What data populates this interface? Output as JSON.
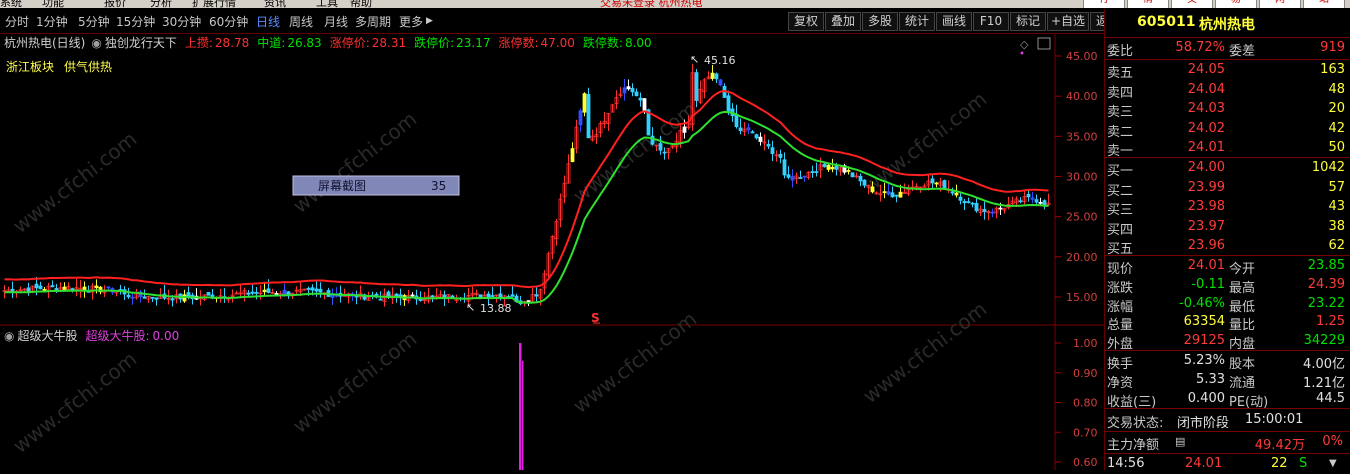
{
  "menu": {
    "items": [
      "系统",
      "功能",
      "报价",
      "分析",
      "扩展行情",
      "资讯",
      "工具",
      "帮助"
    ],
    "center_text": "交易未登录 杭州热电",
    "right_buttons": [
      "行",
      "情",
      "交",
      "易",
      "网",
      "站"
    ]
  },
  "toolbar": {
    "periods": [
      "分时",
      "1分钟",
      "5分钟",
      "15分钟",
      "30分钟",
      "60分钟",
      "日线",
      "周线",
      "月线",
      "多周期",
      "更多"
    ],
    "active_period": "日线",
    "right": [
      "复权",
      "叠加",
      "多股",
      "统计",
      "画线",
      "F10",
      "标记",
      "+自选",
      "返回"
    ]
  },
  "main": {
    "title": "杭州热电(日线)",
    "indicator_name": "独创龙行天下",
    "values": [
      {
        "label": "上攒:",
        "value": "28.78",
        "color": "#ff3030"
      },
      {
        "label": "中道:",
        "value": "26.83",
        "color": "#00e000"
      },
      {
        "label": "涨停价:",
        "value": "28.31",
        "color": "#ff3030"
      },
      {
        "label": "跌停价:",
        "value": "23.17",
        "color": "#00e000"
      },
      {
        "label": "涨停数:",
        "value": "47.00",
        "color": "#ff3030"
      },
      {
        "label": "跌停数:",
        "value": "8.00",
        "color": "#00e000"
      }
    ],
    "tags": [
      "浙江板块",
      "供气供热"
    ],
    "max_label": "45.16",
    "min_label": "13.88",
    "marker": "S",
    "screenshot_box": {
      "label": "屏幕截图",
      "value": "35"
    },
    "y_ticks": [
      "45.00",
      "40.00",
      "35.00",
      "30.00",
      "25.00",
      "20.00",
      "15.00"
    ]
  },
  "sub": {
    "title": "超级大牛股",
    "label": "超级大牛股:",
    "value": "0.00",
    "y_ticks": [
      "1.00",
      "0.90",
      "0.80",
      "0.70",
      "0.60"
    ]
  },
  "watermark": "www.cfchi.com",
  "chart_data": {
    "type": "line",
    "series": [
      {
        "name": "上攒",
        "values": []
      },
      {
        "name": "中道",
        "values": []
      }
    ],
    "ylim": [
      12,
      47
    ]
  },
  "quote": {
    "code": "605011",
    "name": "杭州热电",
    "weibi_label": "委比",
    "weibi": "58.72%",
    "weicha_label": "委差",
    "weicha": "919",
    "sells": [
      {
        "label": "卖五",
        "price": "24.05",
        "vol": "163"
      },
      {
        "label": "卖四",
        "price": "24.04",
        "vol": "48"
      },
      {
        "label": "卖三",
        "price": "24.03",
        "vol": "20"
      },
      {
        "label": "卖二",
        "price": "24.02",
        "vol": "42"
      },
      {
        "label": "卖一",
        "price": "24.01",
        "vol": "50"
      }
    ],
    "buys": [
      {
        "label": "买一",
        "price": "24.00",
        "vol": "1042"
      },
      {
        "label": "买二",
        "price": "23.99",
        "vol": "57"
      },
      {
        "label": "买三",
        "price": "23.98",
        "vol": "43"
      },
      {
        "label": "买四",
        "price": "23.97",
        "vol": "38"
      },
      {
        "label": "买五",
        "price": "23.96",
        "vol": "62"
      }
    ],
    "stats": [
      {
        "l1": "现价",
        "v1": "24.01",
        "c1": "red",
        "l2": "今开",
        "v2": "23.85",
        "c2": "grn"
      },
      {
        "l1": "涨跌",
        "v1": "-0.11",
        "c1": "grn",
        "l2": "最高",
        "v2": "24.39",
        "c2": "red"
      },
      {
        "l1": "涨幅",
        "v1": "-0.46%",
        "c1": "grn",
        "l2": "最低",
        "v2": "23.22",
        "c2": "grn"
      },
      {
        "l1": "总量",
        "v1": "63354",
        "c1": "yel",
        "l2": "量比",
        "v2": "1.25",
        "c2": "red"
      },
      {
        "l1": "外盘",
        "v1": "29125",
        "c1": "red",
        "l2": "内盘",
        "v2": "34229",
        "c2": "grn"
      }
    ],
    "stats2": [
      {
        "l1": "换手",
        "v1": "5.23%",
        "l2": "股本",
        "v2": "4.00亿"
      },
      {
        "l1": "净资",
        "v1": "5.33",
        "l2": "流通",
        "v2": "1.21亿"
      },
      {
        "l1": "收益(三)",
        "v1": "0.400",
        "l2": "PE(动)",
        "v2": "44.5"
      }
    ],
    "state_label": "交易状态:",
    "state": "闭市阶段",
    "state_time": "15:00:01",
    "flow_label": "主力净额",
    "flow_value": "49.42万",
    "flow_pct": "0%",
    "tick": {
      "time": "14:56",
      "price": "24.01",
      "vol": "22",
      "side": "S"
    }
  }
}
